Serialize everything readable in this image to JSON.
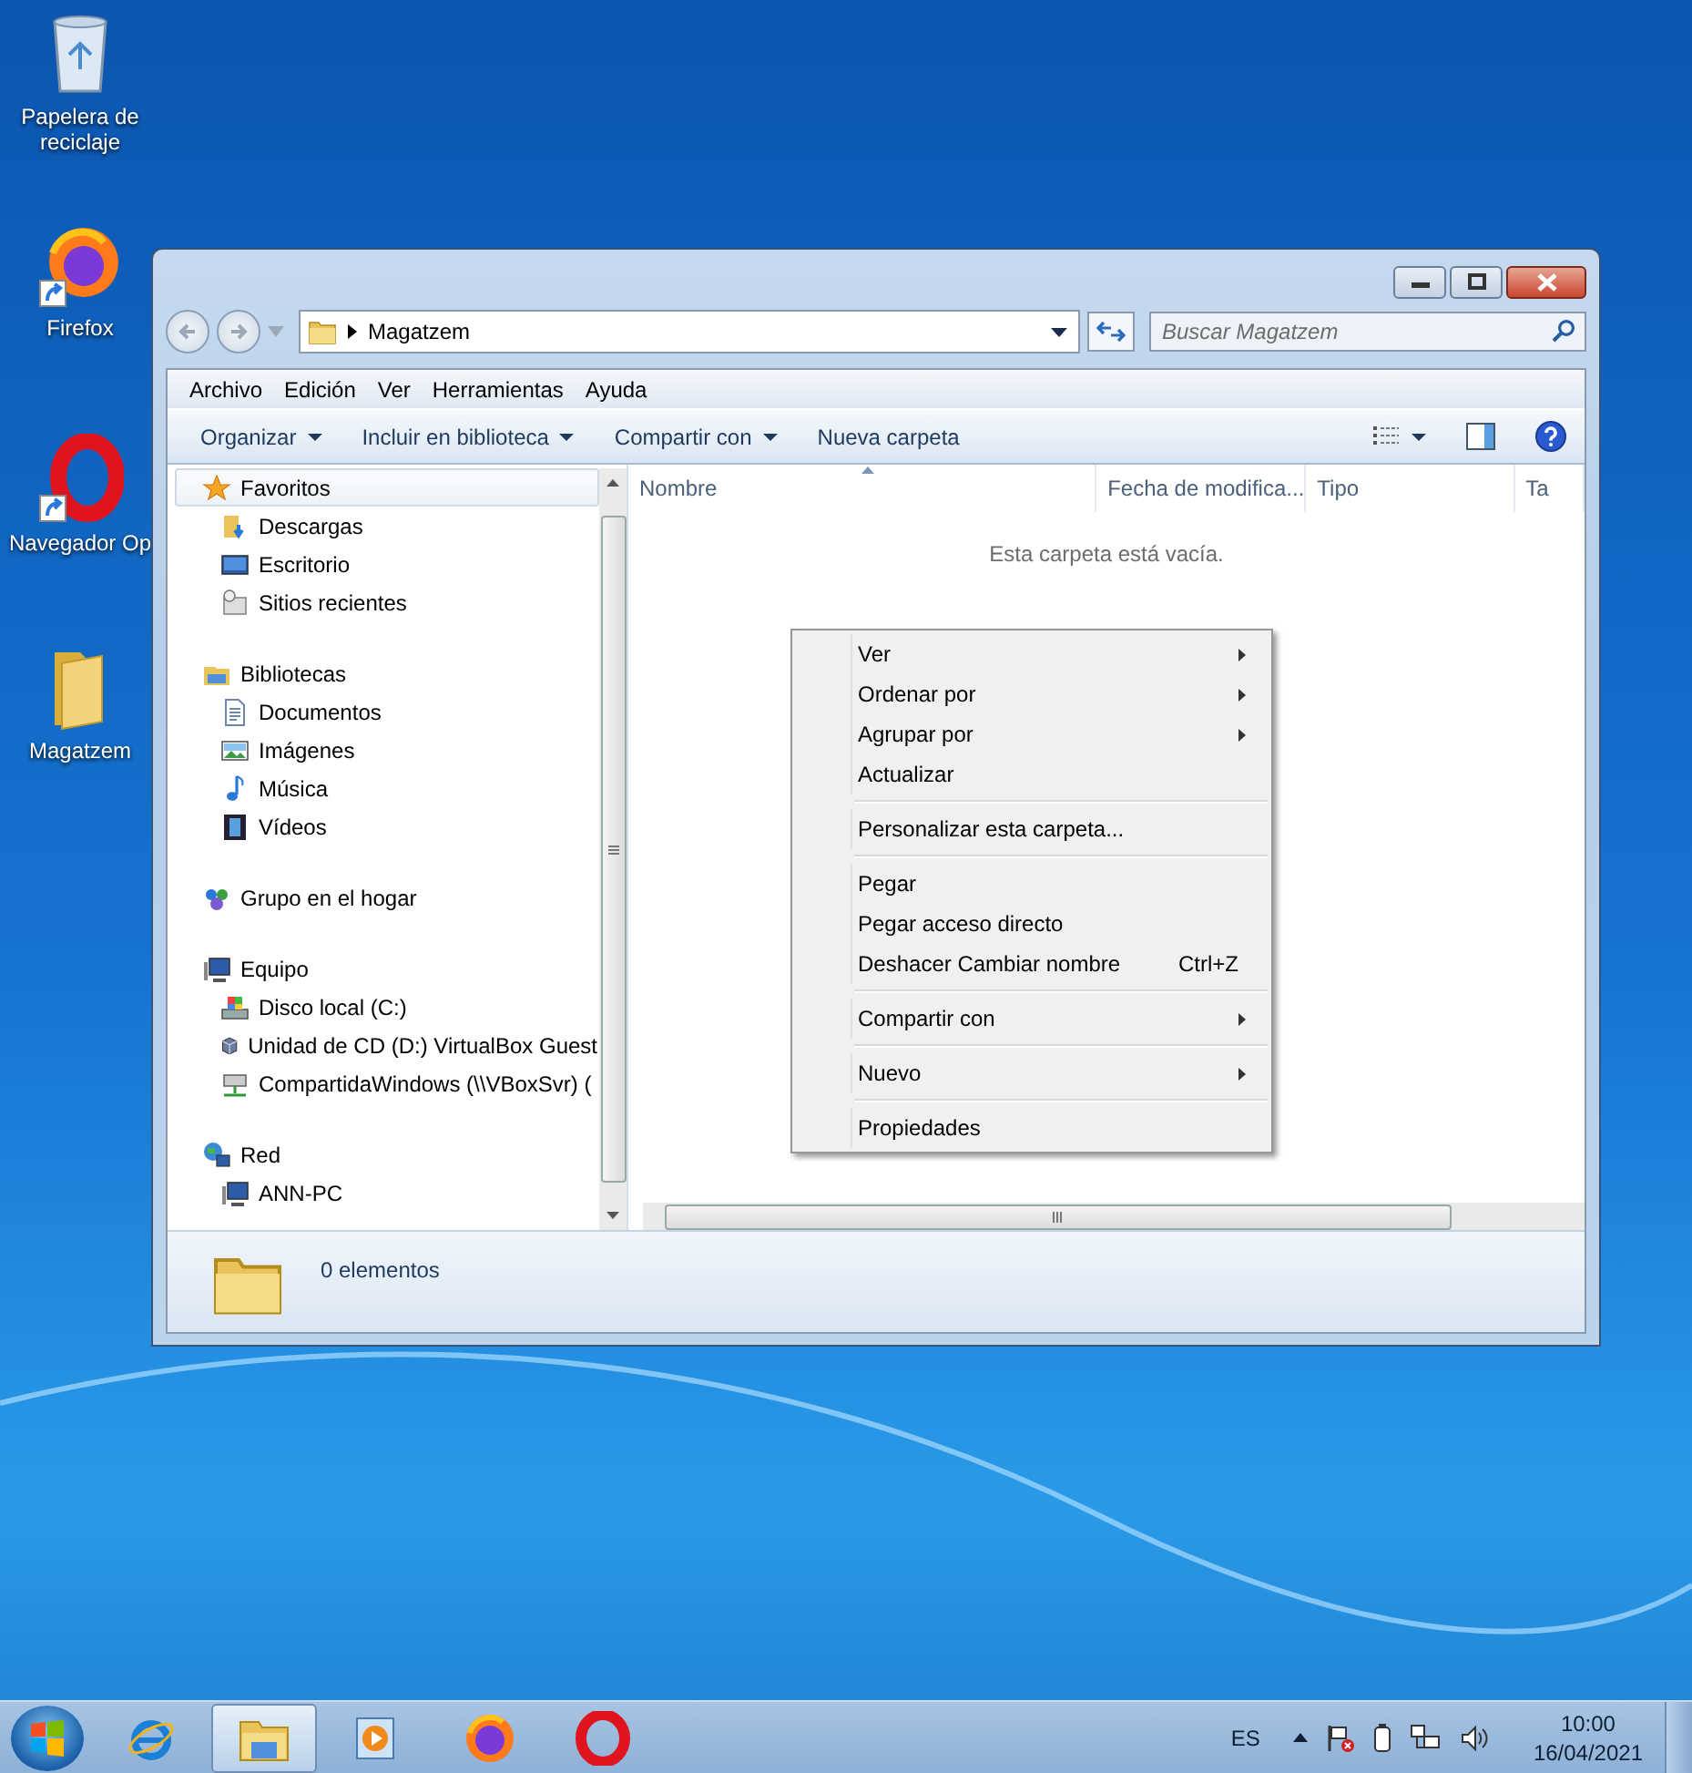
{
  "desktop_icons": [
    {
      "label": "Papelera de reciclaje"
    },
    {
      "label": "Firefox"
    },
    {
      "label": "Navegador Op"
    },
    {
      "label": "Magatzem"
    }
  ],
  "window": {
    "address": "Magatzem",
    "search": {
      "placeholder": "Buscar Magatzem"
    },
    "menu_bar": [
      "Archivo",
      "Edición",
      "Ver",
      "Herramientas",
      "Ayuda"
    ],
    "toolbar": [
      {
        "label": "Organizar",
        "dropdown": true
      },
      {
        "label": "Incluir en biblioteca",
        "dropdown": true
      },
      {
        "label": "Compartir con",
        "dropdown": true
      },
      {
        "label": "Nueva carpeta",
        "dropdown": false
      }
    ],
    "nav_pane": [
      {
        "label": "Favoritos",
        "selected": true,
        "children": [
          {
            "label": "Descargas",
            "selected": false
          },
          {
            "label": "Escritorio",
            "selected": false
          },
          {
            "label": "Sitios recientes",
            "selected": false
          }
        ]
      },
      {
        "label": "Bibliotecas",
        "selected": false,
        "children": [
          {
            "label": "Documentos",
            "selected": false
          },
          {
            "label": "Imágenes",
            "selected": false
          },
          {
            "label": "Música",
            "selected": false
          },
          {
            "label": "Vídeos",
            "selected": false
          }
        ]
      },
      {
        "label": "Grupo en el hogar",
        "selected": false
      },
      {
        "label": "Equipo",
        "selected": false,
        "children": [
          {
            "label": "Disco local (C:)",
            "selected": false
          },
          {
            "label": "Unidad de CD (D:) VirtualBox Guest",
            "selected": false
          },
          {
            "label": "CompartidaWindows (\\\\VBoxSvr) (",
            "selected": false
          }
        ]
      },
      {
        "label": "Red",
        "selected": false,
        "children": [
          {
            "label": "ANN-PC",
            "selected": false
          }
        ]
      }
    ],
    "columns": [
      {
        "label": "Nombre",
        "sorted": true
      },
      {
        "label": "Fecha de modifica...",
        "sorted": false
      },
      {
        "label": "Tipo",
        "sorted": false
      },
      {
        "label": "Ta",
        "sorted": false
      }
    ],
    "empty_message": "Esta carpeta está vacía.",
    "status_bar": {
      "count": "0 elementos"
    }
  },
  "context_menu": {
    "groups": [
      {
        "items": [
          {
            "label": "Ver",
            "submenu": true
          },
          {
            "label": "Ordenar por",
            "submenu": true
          },
          {
            "label": "Agrupar por",
            "submenu": true
          },
          {
            "label": "Actualizar",
            "submenu": false
          }
        ]
      },
      {
        "items": [
          {
            "label": "Personalizar esta carpeta...",
            "submenu": false
          }
        ]
      },
      {
        "items": [
          {
            "label": "Pegar",
            "submenu": false
          },
          {
            "label": "Pegar acceso directo",
            "submenu": false
          },
          {
            "label": "Deshacer Cambiar nombre",
            "submenu": false,
            "shortcut": "Ctrl+Z"
          }
        ]
      },
      {
        "items": [
          {
            "label": "Compartir con",
            "submenu": true
          }
        ]
      },
      {
        "items": [
          {
            "label": "Nuevo",
            "submenu": true
          }
        ]
      },
      {
        "items": [
          {
            "label": "Propiedades",
            "submenu": false
          }
        ]
      }
    ]
  },
  "taskbar": {
    "apps": [
      {
        "selected": false
      },
      {
        "selected": true
      },
      {
        "selected": false
      },
      {
        "selected": false
      },
      {
        "selected": false
      }
    ],
    "language": "ES",
    "time": "10:00",
    "date": "16/04/2021"
  }
}
